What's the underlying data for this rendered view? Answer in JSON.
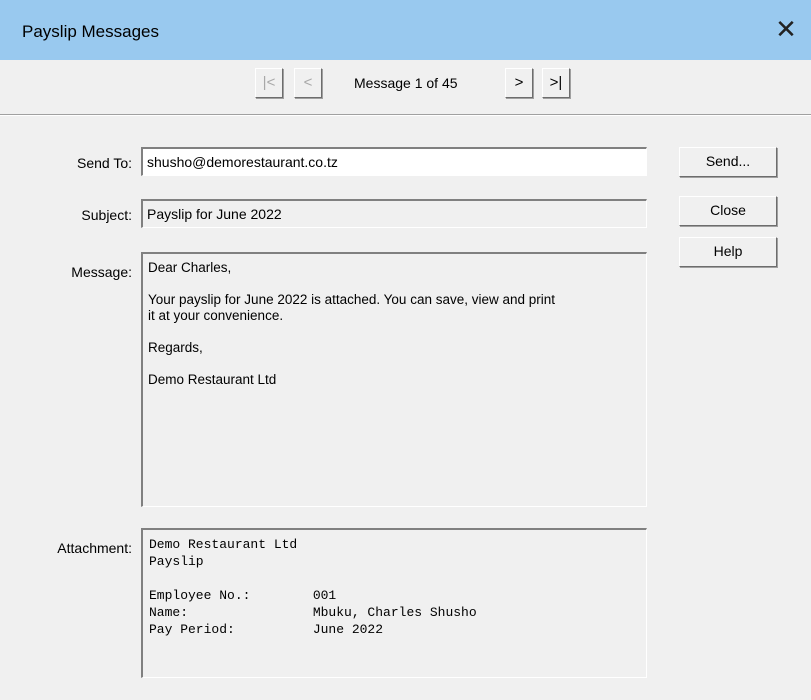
{
  "window": {
    "title": "Payslip Messages",
    "close_glyph": "✕"
  },
  "nav": {
    "first_glyph": "|<",
    "prev_glyph": "<",
    "next_glyph": ">",
    "last_glyph": ">|",
    "counter": "Message 1 of 45"
  },
  "form": {
    "send_to_label": "Send To:",
    "send_to_value": "shusho@demorestaurant.co.tz",
    "subject_label": "Subject:",
    "subject_value": "Payslip for June 2022",
    "message_label": "Message:",
    "message_value": "Dear Charles,\n\nYour payslip for June 2022 is attached. You can save, view and print\nit at your convenience.\n\nRegards,\n\nDemo Restaurant Ltd",
    "attachment_label": "Attachment:",
    "attachment_value": "Demo Restaurant Ltd\nPayslip\n\nEmployee No.:        001\nName:                Mbuku, Charles Shusho\nPay Period:          June 2022"
  },
  "buttons": {
    "send": "Send...",
    "close": "Close",
    "help": "Help"
  }
}
